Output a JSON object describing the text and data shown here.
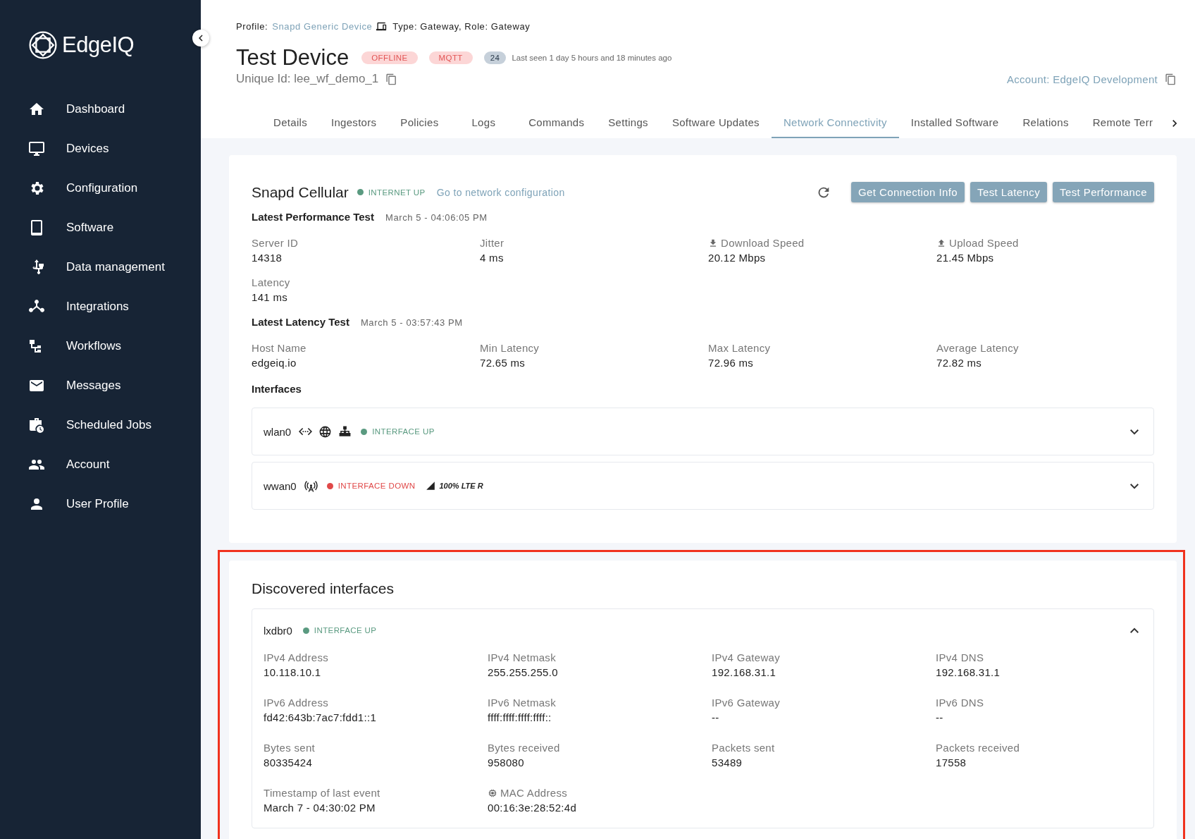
{
  "sidebar": {
    "logo": "EdgeIQ",
    "items": [
      {
        "label": "Dashboard",
        "selected": false
      },
      {
        "label": "Devices",
        "selected": false
      },
      {
        "label": "Configuration",
        "selected": false
      },
      {
        "label": "Software",
        "selected": false
      },
      {
        "label": "Data management",
        "selected": false
      },
      {
        "label": "Integrations",
        "selected": false
      },
      {
        "label": "Workflows",
        "selected": false
      },
      {
        "label": "Messages",
        "selected": false
      },
      {
        "label": "Scheduled Jobs",
        "selected": false
      },
      {
        "label": "Account",
        "selected": false
      },
      {
        "label": "User Profile",
        "selected": false
      }
    ]
  },
  "header": {
    "profile_label": "Profile:",
    "profile_link": "Snapd Generic Device",
    "type_text": "Type: Gateway, Role: Gateway",
    "title": "Test Device",
    "badges": [
      {
        "text": "OFFLINE",
        "kind": "danger"
      },
      {
        "text": "MQTT",
        "kind": "danger"
      },
      {
        "text": "24",
        "kind": "count"
      }
    ],
    "last_seen": "Last seen 1 day 5 hours and 18 minutes ago",
    "unique_id": "Unique Id: lee_wf_demo_1",
    "account": "Account: EdgeIQ Development"
  },
  "tabs": [
    {
      "label": "Details",
      "selected": false
    },
    {
      "label": "Ingestors",
      "selected": false
    },
    {
      "label": "Policies",
      "selected": false
    },
    {
      "label": "Logs",
      "selected": false
    },
    {
      "label": "Commands",
      "selected": false
    },
    {
      "label": "Settings",
      "selected": false
    },
    {
      "label": "Software Updates",
      "selected": false
    },
    {
      "label": "Network Connectivity",
      "selected": true
    },
    {
      "label": "Installed Software",
      "selected": false
    },
    {
      "label": "Relations",
      "selected": false
    },
    {
      "label": "Remote Terr",
      "selected": false
    }
  ],
  "cellular": {
    "title": "Snapd Cellular",
    "status": "INTERNET UP",
    "up": true,
    "link": "Go to network configuration",
    "buttons": [
      "Get Connection Info",
      "Test Latency",
      "Test Performance"
    ],
    "sections": [
      {
        "title": "Latest Performance Test",
        "timestamp": "March 5 - 04:06:05 PM",
        "fields": [
          {
            "label": "Server ID",
            "value": "14318"
          },
          {
            "label": "Jitter",
            "value": "4 ms"
          },
          {
            "label": "Download Speed",
            "value": "20.12 Mbps"
          },
          {
            "label": "Upload Speed",
            "value": "21.45 Mbps"
          },
          {
            "label": "Latency",
            "value": "141 ms"
          }
        ]
      },
      {
        "title": "Latest Latency Test",
        "timestamp": "March 5 - 03:57:43 PM",
        "fields": [
          {
            "label": "Host Name",
            "value": "edgeiq.io"
          },
          {
            "label": "Min Latency",
            "value": "72.65 ms"
          },
          {
            "label": "Max Latency",
            "value": "72.96 ms"
          },
          {
            "label": "Average Latency",
            "value": "72.82 ms"
          }
        ]
      }
    ],
    "interfaces_label": "Interfaces",
    "interfaces": [
      {
        "name": "wlan0",
        "status": "INTERFACE UP",
        "up": true,
        "expanded": false
      },
      {
        "name": "wwan0",
        "status": "INTERFACE DOWN",
        "up": false,
        "signal": "100% LTE R",
        "expanded": false
      }
    ]
  },
  "discovered": {
    "title": "Discovered interfaces",
    "highlighted": true,
    "interfaces": [
      {
        "name": "lxdbr0",
        "status": "INTERFACE UP",
        "up": true,
        "expanded": true,
        "fields": [
          {
            "label": "IPv4 Address",
            "value": "10.118.10.1"
          },
          {
            "label": "IPv4 Netmask",
            "value": "255.255.255.0"
          },
          {
            "label": "IPv4 Gateway",
            "value": "192.168.31.1"
          },
          {
            "label": "IPv4 DNS",
            "value": "192.168.31.1"
          },
          {
            "label": "IPv6 Address",
            "value": "fd42:643b:7ac7:fdd1::1"
          },
          {
            "label": "IPv6 Netmask",
            "value": "ffff:ffff:ffff:ffff::"
          },
          {
            "label": "IPv6 Gateway",
            "value": "--"
          },
          {
            "label": "IPv6 DNS",
            "value": "--"
          },
          {
            "label": "Bytes sent",
            "value": "80335424"
          },
          {
            "label": "Bytes received",
            "value": "958080"
          },
          {
            "label": "Packets sent",
            "value": "53489"
          },
          {
            "label": "Packets received",
            "value": "17558"
          },
          {
            "label": "Timestamp of last event",
            "value": "March 7 - 04:30:02 PM"
          },
          {
            "label": "MAC Address",
            "value": "00:16:3e:28:52:4d"
          }
        ]
      }
    ]
  }
}
